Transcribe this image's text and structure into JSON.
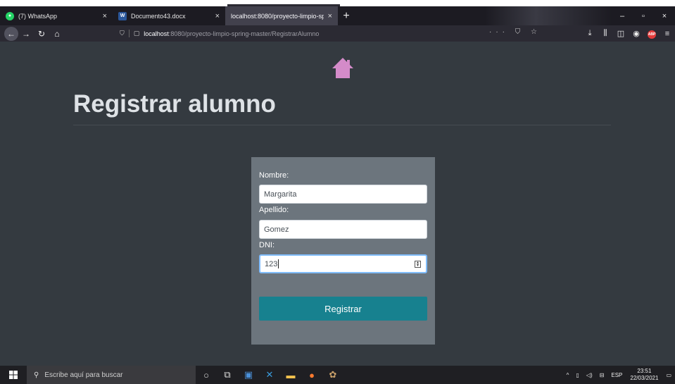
{
  "browser": {
    "tabs": [
      {
        "label": "(7) WhatsApp",
        "close": "×",
        "icon": "whatsapp-icon"
      },
      {
        "label": "Documento43.docx",
        "close": "×",
        "icon": "word-icon"
      },
      {
        "label": "localhost:8080/proyecto-limpio-sp",
        "close": "×",
        "active": true
      }
    ],
    "new_tab": "+",
    "window_controls": {
      "minimize": "–",
      "maximize": "▫",
      "close": "×"
    },
    "nav": {
      "back": "←",
      "forward": "→",
      "reload": "↻",
      "home": "⌂"
    },
    "url": {
      "host": "localhost",
      "path": ":8080/proyecto-limpio-spring-master/RegistrarAlumno"
    },
    "url_actions": "··· ⛉ ☆",
    "toolbar_icons": {
      "download": "⤓",
      "library": "⫼",
      "sidebar": "◫",
      "account": "◉",
      "abp": "ABP",
      "menu": "≡"
    }
  },
  "page": {
    "title": "Registrar alumno",
    "form": {
      "nombre_label": "Nombre:",
      "nombre_value": "Margarita",
      "apellido_label": "Apellido:",
      "apellido_value": "Gomez",
      "dni_label": "DNI:",
      "dni_value": "123",
      "submit_label": "Registrar"
    },
    "colors": {
      "background": "#343a40",
      "card": "#6c757d",
      "button": "#17818f",
      "home_icon": "#d48bc9"
    }
  },
  "taskbar": {
    "search_placeholder": "Escribe aquí para buscar",
    "tray": {
      "language": "ESP",
      "time": "23:51",
      "date": "22/03/2021"
    }
  }
}
